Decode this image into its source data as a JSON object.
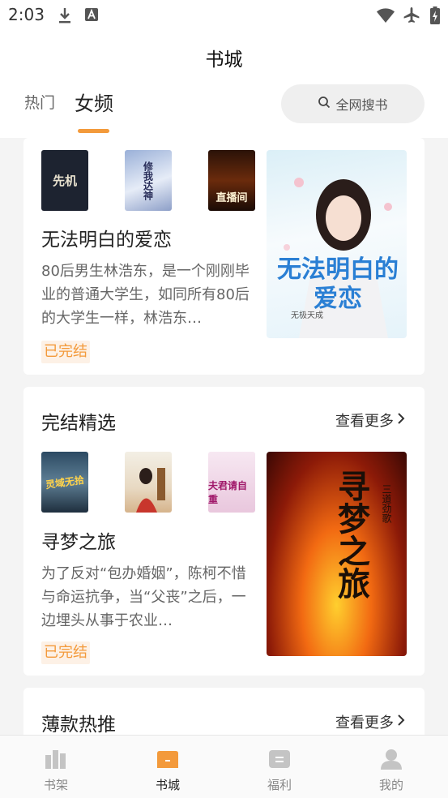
{
  "status_bar": {
    "time": "2:03"
  },
  "header": {
    "title": "书城",
    "tabs": [
      {
        "label": "热门"
      },
      {
        "label": "女频"
      }
    ],
    "search": {
      "label": "全网搜书"
    }
  },
  "featured": {
    "thumbs": [
      {
        "title": "先机",
        "icon": "book-cover"
      },
      {
        "title": "修我达神",
        "icon": "book-cover"
      },
      {
        "title": "直播间",
        "icon": "book-cover"
      }
    ],
    "book": {
      "title": "无法明白的爱恋",
      "description": "80后男生林浩东，是一个刚刚毕业的普通大学生，如同所有80后的大学生一样，林浩东…",
      "status": "已完结",
      "cover_title": "无法明白的爱恋",
      "cover_author": "无极天成"
    }
  },
  "completed_section": {
    "title": "完结精选",
    "more": "查看更多",
    "thumbs": [
      {
        "title": "灵域无拾",
        "icon": "book-cover"
      },
      {
        "title": "",
        "icon": "book-cover"
      },
      {
        "title": "夫君请自重",
        "icon": "book-cover"
      }
    ],
    "book": {
      "title": "寻梦之旅",
      "description": "为了反对“包办婚姻”，陈柯不惜与命运抗争，当“父丧”之后，一边埋头从事于农业…",
      "status": "已完结",
      "cover_title": "寻梦之旅",
      "cover_author": "三道劲歌"
    }
  },
  "hot_section": {
    "title": "薄款热推",
    "more": "查看更多"
  },
  "bottom_nav": [
    {
      "label": "书架",
      "icon": "bookshelf-icon"
    },
    {
      "label": "书城",
      "icon": "bookstore-icon",
      "active": true
    },
    {
      "label": "福利",
      "icon": "welfare-icon"
    },
    {
      "label": "我的",
      "icon": "profile-icon"
    }
  ],
  "colors": {
    "accent": "#f39a3b",
    "background": "#f4f4f4"
  }
}
